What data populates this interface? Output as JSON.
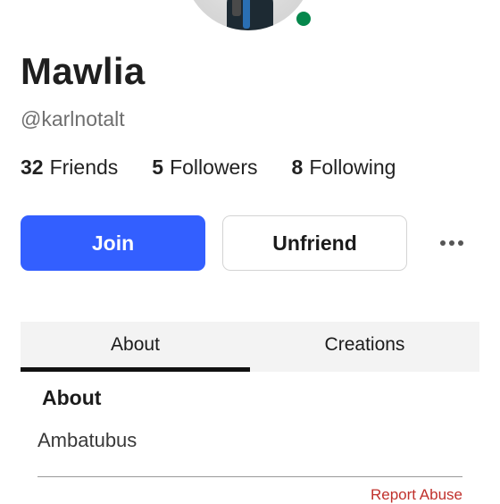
{
  "profile": {
    "display_name": "Mawlia",
    "username": "@karlnotalt",
    "online_status_color": "#05874c"
  },
  "stats": [
    {
      "count": "32",
      "label": "Friends"
    },
    {
      "count": "5",
      "label": "Followers"
    },
    {
      "count": "8",
      "label": "Following"
    }
  ],
  "actions": {
    "join_label": "Join",
    "unfriend_label": "Unfriend",
    "more_icon": "ellipsis-icon",
    "join_color": "#335fff"
  },
  "tabs": [
    {
      "label": "About",
      "active": true
    },
    {
      "label": "Creations",
      "active": false
    }
  ],
  "about": {
    "heading": "About",
    "text": "Ambatubus",
    "report_label": "Report Abuse",
    "report_color": "#c0302b"
  }
}
